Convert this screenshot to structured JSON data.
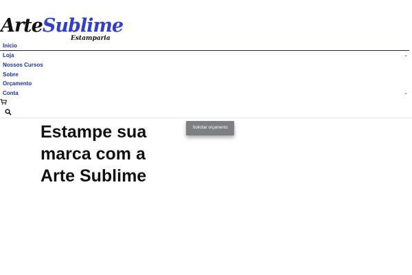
{
  "brand": {
    "logo_word_1": "Arte",
    "logo_word_2": "Sublime",
    "logo_subtitle": "Estamparia",
    "accent_color": "#2f3fd3"
  },
  "nav": {
    "items": [
      {
        "label": "Inicio",
        "has_submenu": false
      },
      {
        "label": "Loja",
        "has_submenu": true
      },
      {
        "label": "Nossos Cursos",
        "has_submenu": false
      },
      {
        "label": "Sobre",
        "has_submenu": false
      },
      {
        "label": "Orçamento",
        "has_submenu": false
      },
      {
        "label": "Conta",
        "has_submenu": true
      }
    ],
    "link_color": "#1c2fae",
    "icons": [
      "cart-icon",
      "search-icon"
    ]
  },
  "hero": {
    "title_lines": [
      "Estampe sua",
      "marca com a",
      "Arte Sublime"
    ],
    "cta_label": "Solicitar orçamento",
    "cta_color": "#7d7f83"
  }
}
